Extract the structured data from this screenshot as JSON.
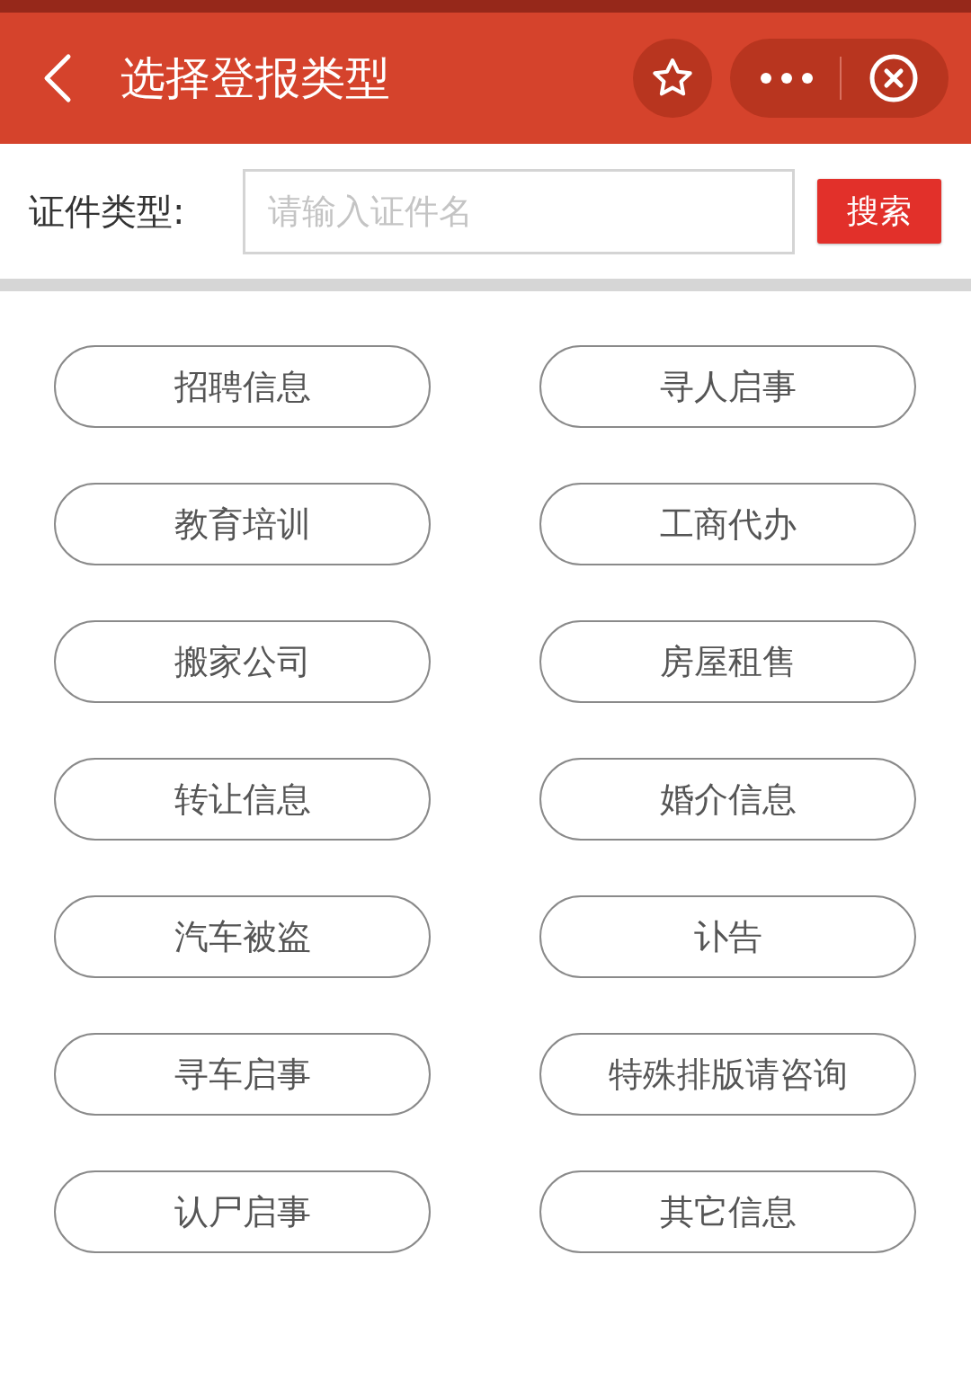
{
  "header": {
    "title": "选择登报类型"
  },
  "search": {
    "label": "证件类型:",
    "placeholder": "请输入证件名",
    "button": "搜索"
  },
  "categories": [
    {
      "label": "招聘信息"
    },
    {
      "label": "寻人启事"
    },
    {
      "label": "教育培训"
    },
    {
      "label": "工商代办"
    },
    {
      "label": "搬家公司"
    },
    {
      "label": "房屋租售"
    },
    {
      "label": "转让信息"
    },
    {
      "label": "婚介信息"
    },
    {
      "label": "汽车被盗"
    },
    {
      "label": "讣告"
    },
    {
      "label": "寻车启事"
    },
    {
      "label": "特殊排版请咨询"
    },
    {
      "label": "认尸启事"
    },
    {
      "label": "其它信息"
    }
  ]
}
